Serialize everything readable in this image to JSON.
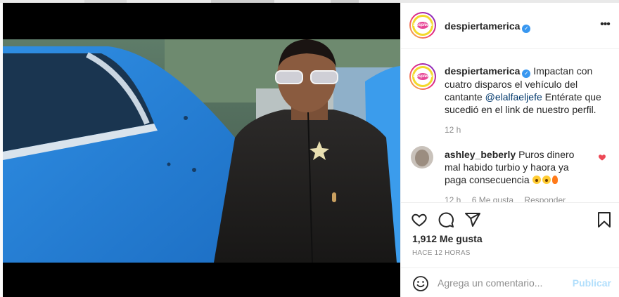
{
  "post": {
    "username": "despiertamerica",
    "more_label": "•••",
    "logo_text": "Despierta"
  },
  "caption": {
    "username": "despiertamerica",
    "text_before": "Impactan con cuatro disparos el vehículo del cantante ",
    "mention": "@elalfaeljefe",
    "text_after": " Entérate que sucedió en el link de nuestro perfil.",
    "time": "12 h"
  },
  "comment": {
    "username": "ashley_beberly",
    "text": "Puros dinero mal habido turbio y haora ya paga consecuencia",
    "time": "12 h",
    "likes": "6 Me gusta",
    "reply": "Responder"
  },
  "actions": {
    "likes": "1,912 Me gusta",
    "ago": "HACE 12 HORAS"
  },
  "composer": {
    "placeholder": "Agrega un comentario...",
    "post_label": "Publicar"
  },
  "colors": {
    "link": "#00376b",
    "muted": "#8e8e8e",
    "verified": "#3897f0",
    "heart": "#ed4956",
    "publish_disabled": "#b2dffc"
  },
  "icons": [
    "verified-badge-icon",
    "more-options-icon",
    "heart-icon",
    "comment-icon",
    "share-icon",
    "bookmark-icon",
    "emoji-icon"
  ]
}
